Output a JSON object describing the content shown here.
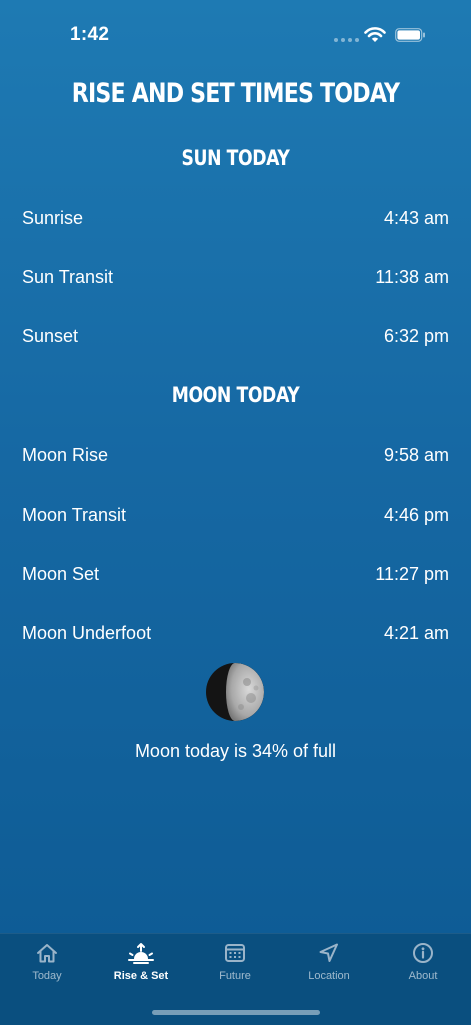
{
  "status": {
    "time": "1:42"
  },
  "title": "RISE AND SET TIMES TODAY",
  "sun": {
    "heading": "SUN TODAY",
    "rows": [
      {
        "label": "Sunrise",
        "value": "4:43 am"
      },
      {
        "label": "Sun Transit",
        "value": "11:38 am"
      },
      {
        "label": "Sunset",
        "value": "6:32 pm"
      }
    ]
  },
  "moon": {
    "heading": "MOON TODAY",
    "rows": [
      {
        "label": "Moon Rise",
        "value": "9:58 am"
      },
      {
        "label": "Moon Transit",
        "value": "4:46 pm"
      },
      {
        "label": "Moon Set",
        "value": "11:27 pm"
      },
      {
        "label": "Moon Underfoot",
        "value": "4:21 am"
      }
    ],
    "caption": "Moon today is 34% of full",
    "illumination_percent": 34
  },
  "tabs": [
    {
      "label": "Today",
      "icon": "home-icon",
      "active": false
    },
    {
      "label": "Rise & Set",
      "icon": "sunrise-icon",
      "active": true
    },
    {
      "label": "Future",
      "icon": "calendar-icon",
      "active": false
    },
    {
      "label": "Location",
      "icon": "location-arrow-icon",
      "active": false
    },
    {
      "label": "About",
      "icon": "info-icon",
      "active": false
    }
  ],
  "colors": {
    "background": "#1a70ab",
    "tab_bar": "#0a4f7f",
    "inactive_tab": "#9ab4c9"
  }
}
